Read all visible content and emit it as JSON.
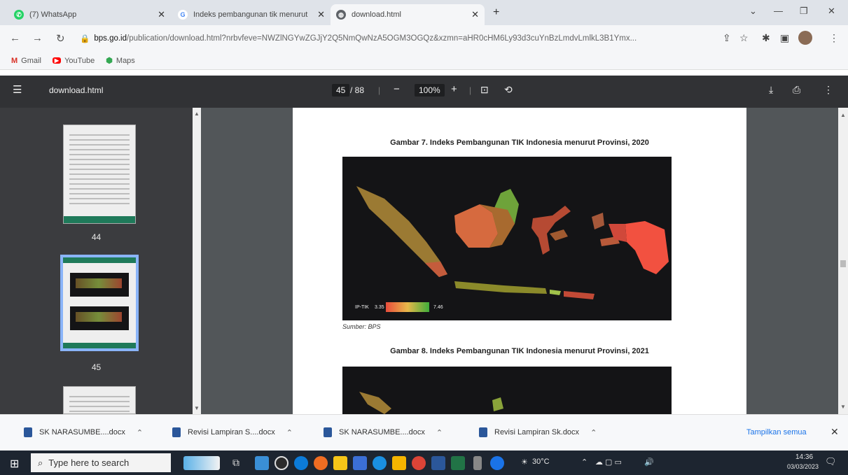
{
  "tabs": [
    {
      "title": "(7) WhatsApp",
      "fav": "whatsapp-icon",
      "color": "#25d366",
      "glyph": "•"
    },
    {
      "title": "Indeks pembangunan tik menurut",
      "fav": "google-icon",
      "color": "#ffffff",
      "glyph": "G"
    },
    {
      "title": "download.html",
      "fav": "globe-icon",
      "color": "#5f6368",
      "glyph": "◍"
    }
  ],
  "address": {
    "host": "bps.go.id",
    "path": "/publication/download.html?nrbvfeve=NWZlNGYwZGJjY2Q5NmQwNzA5OGM3OGQz&xzmn=aHR0cHM6Ly93d3cuYnBzLmdvLmlkL3B1Ymx..."
  },
  "bookmarks": [
    {
      "label": "Gmail",
      "icon": "gmail-icon",
      "glyph": "M",
      "color": "#d93025"
    },
    {
      "label": "YouTube",
      "icon": "youtube-icon",
      "glyph": "▶",
      "color": "#ff0000"
    },
    {
      "label": "Maps",
      "icon": "maps-icon",
      "glyph": "📍",
      "color": "#34a853"
    }
  ],
  "viewer": {
    "filename": "download.html",
    "page_current": "45",
    "page_total": "/ 88",
    "zoom": "100%"
  },
  "thumbnails": [
    {
      "label": "44"
    },
    {
      "label": "45"
    }
  ],
  "figures": [
    {
      "caption": "Gambar 7. Indeks Pembangunan TIK Indonesia menurut Provinsi, 2020",
      "legend_label": "IP-TIK",
      "legend_min": "3.35",
      "legend_max": "7.46"
    },
    {
      "caption": "Gambar 8. Indeks Pembangunan TIK Indonesia menurut Provinsi, 2021"
    }
  ],
  "source": "Sumber:  BPS",
  "downloads": [
    {
      "name": "SK NARASUMBE....docx"
    },
    {
      "name": "Revisi Lampiran S....docx"
    },
    {
      "name": "SK NARASUMBE....docx"
    },
    {
      "name": "Revisi Lampiran Sk.docx"
    }
  ],
  "show_all": "Tampilkan semua",
  "taskbar": {
    "search_placeholder": "Type here to search",
    "weather": "30°C",
    "time": "14:36",
    "date": "03/03/2023"
  }
}
